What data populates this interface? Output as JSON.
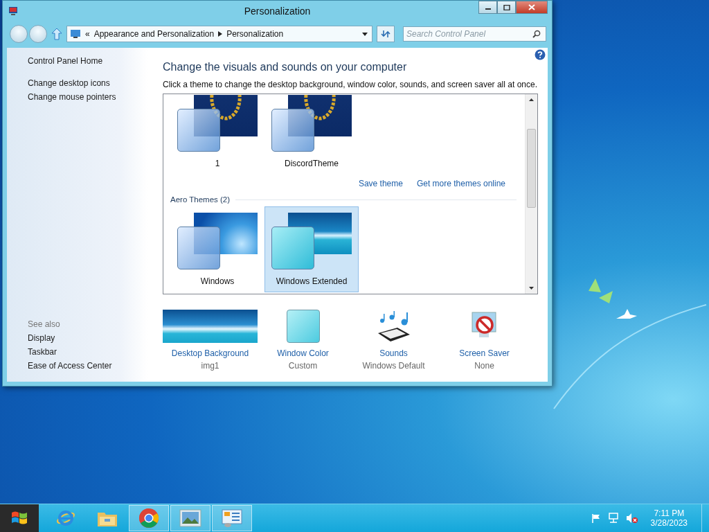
{
  "window": {
    "title": "Personalization"
  },
  "address_bar": {
    "overflow": "«",
    "crumbs": [
      "Appearance and Personalization",
      "Personalization"
    ]
  },
  "search": {
    "placeholder": "Search Control Panel"
  },
  "sidebar": {
    "items": [
      "Control Panel Home",
      "Change desktop icons",
      "Change mouse pointers"
    ],
    "see_also_heading": "See also",
    "see_also": [
      "Display",
      "Taskbar",
      "Ease of Access Center"
    ]
  },
  "heading": "Change the visuals and sounds on your computer",
  "description": "Click a theme to change the desktop background, window color, sounds, and screen saver all at once.",
  "theme_groups": [
    {
      "items": [
        {
          "name": "1",
          "kind": "emblem",
          "selected": false
        },
        {
          "name": "DiscordTheme",
          "kind": "emblem",
          "selected": false
        }
      ],
      "links": [
        "Save theme",
        "Get more themes online"
      ]
    },
    {
      "title": "Aero Themes (2)",
      "items": [
        {
          "name": "Windows",
          "kind": "sky",
          "selected": false
        },
        {
          "name": "Windows Extended",
          "kind": "sea",
          "selected": true
        }
      ]
    }
  ],
  "settings": [
    {
      "kind": "background",
      "label": "Desktop Background",
      "value": "img1"
    },
    {
      "kind": "color",
      "label": "Window Color",
      "value": "Custom"
    },
    {
      "kind": "sounds",
      "label": "Sounds",
      "value": "Windows Default"
    },
    {
      "kind": "screensaver",
      "label": "Screen Saver",
      "value": "None"
    }
  ],
  "taskbar": {
    "apps": [
      {
        "kind": "browser-e",
        "open": false
      },
      {
        "kind": "folder",
        "open": false
      },
      {
        "kind": "chrome",
        "open": true
      },
      {
        "kind": "photo",
        "open": true
      },
      {
        "kind": "panel",
        "open": true
      }
    ],
    "clock": {
      "time": "7:11 PM",
      "date": "3/28/2023"
    }
  }
}
